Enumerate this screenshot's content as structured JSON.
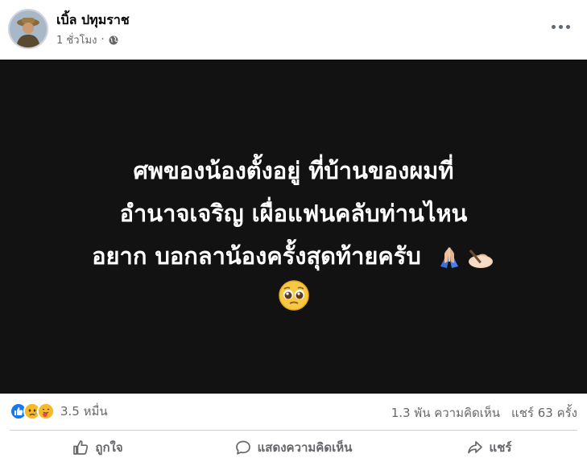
{
  "post": {
    "author": "เบิ้ล ปทุมราช",
    "time": "1 ชั่วโมง",
    "separator": "·"
  },
  "media": {
    "lines": [
      "ศพของน้องตั้งอยู่ ที่บ้านของผมที่",
      "อำนาจเจริญ เผื่อแฟนคลับท่านไหน",
      "อยาก บอกลาน้องครั้งสุดท้ายครับ"
    ],
    "emojis": [
      "folded-hands",
      "writing-hand",
      "pleading-face"
    ]
  },
  "stats": {
    "reactions_count": "3.5 หมื่น",
    "comments": "1.3 พัน ความคิดเห็น",
    "shares": "แชร์ 63 ครั้ง"
  },
  "actions": {
    "like": "ถูกใจ",
    "comment": "แสดงความคิดเห็น",
    "share": "แชร์"
  },
  "colors": {
    "like_blue": "#1877f2",
    "sad_yellow": "#f7b928",
    "media_bg": "#121213",
    "muted_text": "#65676b"
  }
}
